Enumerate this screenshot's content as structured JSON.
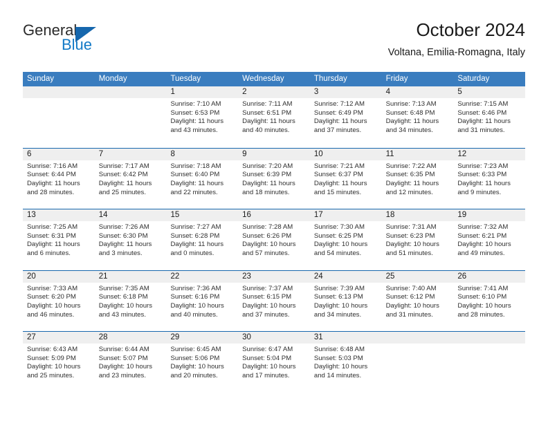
{
  "brand": {
    "name_part1": "General",
    "name_part2": "Blue",
    "triangle_icon": "triangle-icon"
  },
  "header": {
    "title": "October 2024",
    "subtitle": "Voltana, Emilia-Romagna, Italy"
  },
  "colors": {
    "header_blue": "#3a7dbf",
    "rule_blue": "#1667ad",
    "day_band_gray": "#efefef",
    "brand_blue": "#1279c6"
  },
  "weekdays": [
    "Sunday",
    "Monday",
    "Tuesday",
    "Wednesday",
    "Thursday",
    "Friday",
    "Saturday"
  ],
  "weeks": [
    [
      {
        "day": "",
        "sunrise": "",
        "sunset": "",
        "daylight1": "",
        "daylight2": "",
        "empty": true
      },
      {
        "day": "",
        "sunrise": "",
        "sunset": "",
        "daylight1": "",
        "daylight2": "",
        "empty": true
      },
      {
        "day": "1",
        "sunrise": "Sunrise: 7:10 AM",
        "sunset": "Sunset: 6:53 PM",
        "daylight1": "Daylight: 11 hours",
        "daylight2": "and 43 minutes."
      },
      {
        "day": "2",
        "sunrise": "Sunrise: 7:11 AM",
        "sunset": "Sunset: 6:51 PM",
        "daylight1": "Daylight: 11 hours",
        "daylight2": "and 40 minutes."
      },
      {
        "day": "3",
        "sunrise": "Sunrise: 7:12 AM",
        "sunset": "Sunset: 6:49 PM",
        "daylight1": "Daylight: 11 hours",
        "daylight2": "and 37 minutes."
      },
      {
        "day": "4",
        "sunrise": "Sunrise: 7:13 AM",
        "sunset": "Sunset: 6:48 PM",
        "daylight1": "Daylight: 11 hours",
        "daylight2": "and 34 minutes."
      },
      {
        "day": "5",
        "sunrise": "Sunrise: 7:15 AM",
        "sunset": "Sunset: 6:46 PM",
        "daylight1": "Daylight: 11 hours",
        "daylight2": "and 31 minutes."
      }
    ],
    [
      {
        "day": "6",
        "sunrise": "Sunrise: 7:16 AM",
        "sunset": "Sunset: 6:44 PM",
        "daylight1": "Daylight: 11 hours",
        "daylight2": "and 28 minutes."
      },
      {
        "day": "7",
        "sunrise": "Sunrise: 7:17 AM",
        "sunset": "Sunset: 6:42 PM",
        "daylight1": "Daylight: 11 hours",
        "daylight2": "and 25 minutes."
      },
      {
        "day": "8",
        "sunrise": "Sunrise: 7:18 AM",
        "sunset": "Sunset: 6:40 PM",
        "daylight1": "Daylight: 11 hours",
        "daylight2": "and 22 minutes."
      },
      {
        "day": "9",
        "sunrise": "Sunrise: 7:20 AM",
        "sunset": "Sunset: 6:39 PM",
        "daylight1": "Daylight: 11 hours",
        "daylight2": "and 18 minutes."
      },
      {
        "day": "10",
        "sunrise": "Sunrise: 7:21 AM",
        "sunset": "Sunset: 6:37 PM",
        "daylight1": "Daylight: 11 hours",
        "daylight2": "and 15 minutes."
      },
      {
        "day": "11",
        "sunrise": "Sunrise: 7:22 AM",
        "sunset": "Sunset: 6:35 PM",
        "daylight1": "Daylight: 11 hours",
        "daylight2": "and 12 minutes."
      },
      {
        "day": "12",
        "sunrise": "Sunrise: 7:23 AM",
        "sunset": "Sunset: 6:33 PM",
        "daylight1": "Daylight: 11 hours",
        "daylight2": "and 9 minutes."
      }
    ],
    [
      {
        "day": "13",
        "sunrise": "Sunrise: 7:25 AM",
        "sunset": "Sunset: 6:31 PM",
        "daylight1": "Daylight: 11 hours",
        "daylight2": "and 6 minutes."
      },
      {
        "day": "14",
        "sunrise": "Sunrise: 7:26 AM",
        "sunset": "Sunset: 6:30 PM",
        "daylight1": "Daylight: 11 hours",
        "daylight2": "and 3 minutes."
      },
      {
        "day": "15",
        "sunrise": "Sunrise: 7:27 AM",
        "sunset": "Sunset: 6:28 PM",
        "daylight1": "Daylight: 11 hours",
        "daylight2": "and 0 minutes."
      },
      {
        "day": "16",
        "sunrise": "Sunrise: 7:28 AM",
        "sunset": "Sunset: 6:26 PM",
        "daylight1": "Daylight: 10 hours",
        "daylight2": "and 57 minutes."
      },
      {
        "day": "17",
        "sunrise": "Sunrise: 7:30 AM",
        "sunset": "Sunset: 6:25 PM",
        "daylight1": "Daylight: 10 hours",
        "daylight2": "and 54 minutes."
      },
      {
        "day": "18",
        "sunrise": "Sunrise: 7:31 AM",
        "sunset": "Sunset: 6:23 PM",
        "daylight1": "Daylight: 10 hours",
        "daylight2": "and 51 minutes."
      },
      {
        "day": "19",
        "sunrise": "Sunrise: 7:32 AM",
        "sunset": "Sunset: 6:21 PM",
        "daylight1": "Daylight: 10 hours",
        "daylight2": "and 49 minutes."
      }
    ],
    [
      {
        "day": "20",
        "sunrise": "Sunrise: 7:33 AM",
        "sunset": "Sunset: 6:20 PM",
        "daylight1": "Daylight: 10 hours",
        "daylight2": "and 46 minutes."
      },
      {
        "day": "21",
        "sunrise": "Sunrise: 7:35 AM",
        "sunset": "Sunset: 6:18 PM",
        "daylight1": "Daylight: 10 hours",
        "daylight2": "and 43 minutes."
      },
      {
        "day": "22",
        "sunrise": "Sunrise: 7:36 AM",
        "sunset": "Sunset: 6:16 PM",
        "daylight1": "Daylight: 10 hours",
        "daylight2": "and 40 minutes."
      },
      {
        "day": "23",
        "sunrise": "Sunrise: 7:37 AM",
        "sunset": "Sunset: 6:15 PM",
        "daylight1": "Daylight: 10 hours",
        "daylight2": "and 37 minutes."
      },
      {
        "day": "24",
        "sunrise": "Sunrise: 7:39 AM",
        "sunset": "Sunset: 6:13 PM",
        "daylight1": "Daylight: 10 hours",
        "daylight2": "and 34 minutes."
      },
      {
        "day": "25",
        "sunrise": "Sunrise: 7:40 AM",
        "sunset": "Sunset: 6:12 PM",
        "daylight1": "Daylight: 10 hours",
        "daylight2": "and 31 minutes."
      },
      {
        "day": "26",
        "sunrise": "Sunrise: 7:41 AM",
        "sunset": "Sunset: 6:10 PM",
        "daylight1": "Daylight: 10 hours",
        "daylight2": "and 28 minutes."
      }
    ],
    [
      {
        "day": "27",
        "sunrise": "Sunrise: 6:43 AM",
        "sunset": "Sunset: 5:09 PM",
        "daylight1": "Daylight: 10 hours",
        "daylight2": "and 25 minutes."
      },
      {
        "day": "28",
        "sunrise": "Sunrise: 6:44 AM",
        "sunset": "Sunset: 5:07 PM",
        "daylight1": "Daylight: 10 hours",
        "daylight2": "and 23 minutes."
      },
      {
        "day": "29",
        "sunrise": "Sunrise: 6:45 AM",
        "sunset": "Sunset: 5:06 PM",
        "daylight1": "Daylight: 10 hours",
        "daylight2": "and 20 minutes."
      },
      {
        "day": "30",
        "sunrise": "Sunrise: 6:47 AM",
        "sunset": "Sunset: 5:04 PM",
        "daylight1": "Daylight: 10 hours",
        "daylight2": "and 17 minutes."
      },
      {
        "day": "31",
        "sunrise": "Sunrise: 6:48 AM",
        "sunset": "Sunset: 5:03 PM",
        "daylight1": "Daylight: 10 hours",
        "daylight2": "and 14 minutes."
      },
      {
        "day": "",
        "sunrise": "",
        "sunset": "",
        "daylight1": "",
        "daylight2": "",
        "empty": true
      },
      {
        "day": "",
        "sunrise": "",
        "sunset": "",
        "daylight1": "",
        "daylight2": "",
        "empty": true
      }
    ]
  ]
}
